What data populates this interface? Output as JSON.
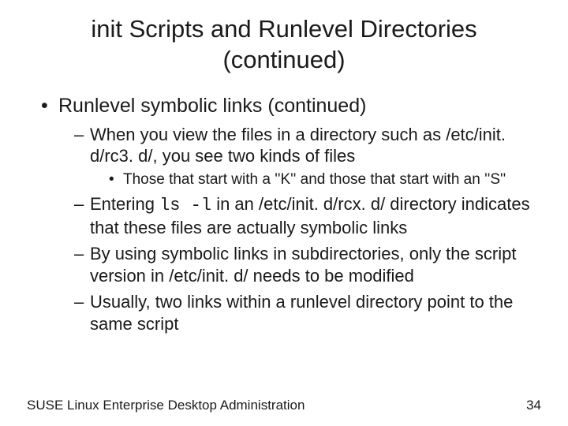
{
  "title_line1": "init Scripts and Runlevel Directories",
  "title_line2": "(continued)",
  "lvl1_1": "Runlevel symbolic links (continued)",
  "lvl2_1": "When you view the files in a directory such as /etc/init. d/rc3. d/, you see two kinds of files",
  "lvl3_1": "Those that start with a ''K'' and those that start with an ''S''",
  "lvl2_2a": "Entering ",
  "lvl2_2_code": "ls -l",
  "lvl2_2b": " in an /etc/init. d/rcx. d/ directory indicates that these files are actually symbolic links",
  "lvl2_3": "By using symbolic links in subdirectories, only the script version in /etc/init. d/ needs to be modified",
  "lvl2_4": "Usually, two links within a runlevel directory point to the same script",
  "footer_left": "SUSE Linux Enterprise Desktop Administration",
  "footer_right": "34"
}
